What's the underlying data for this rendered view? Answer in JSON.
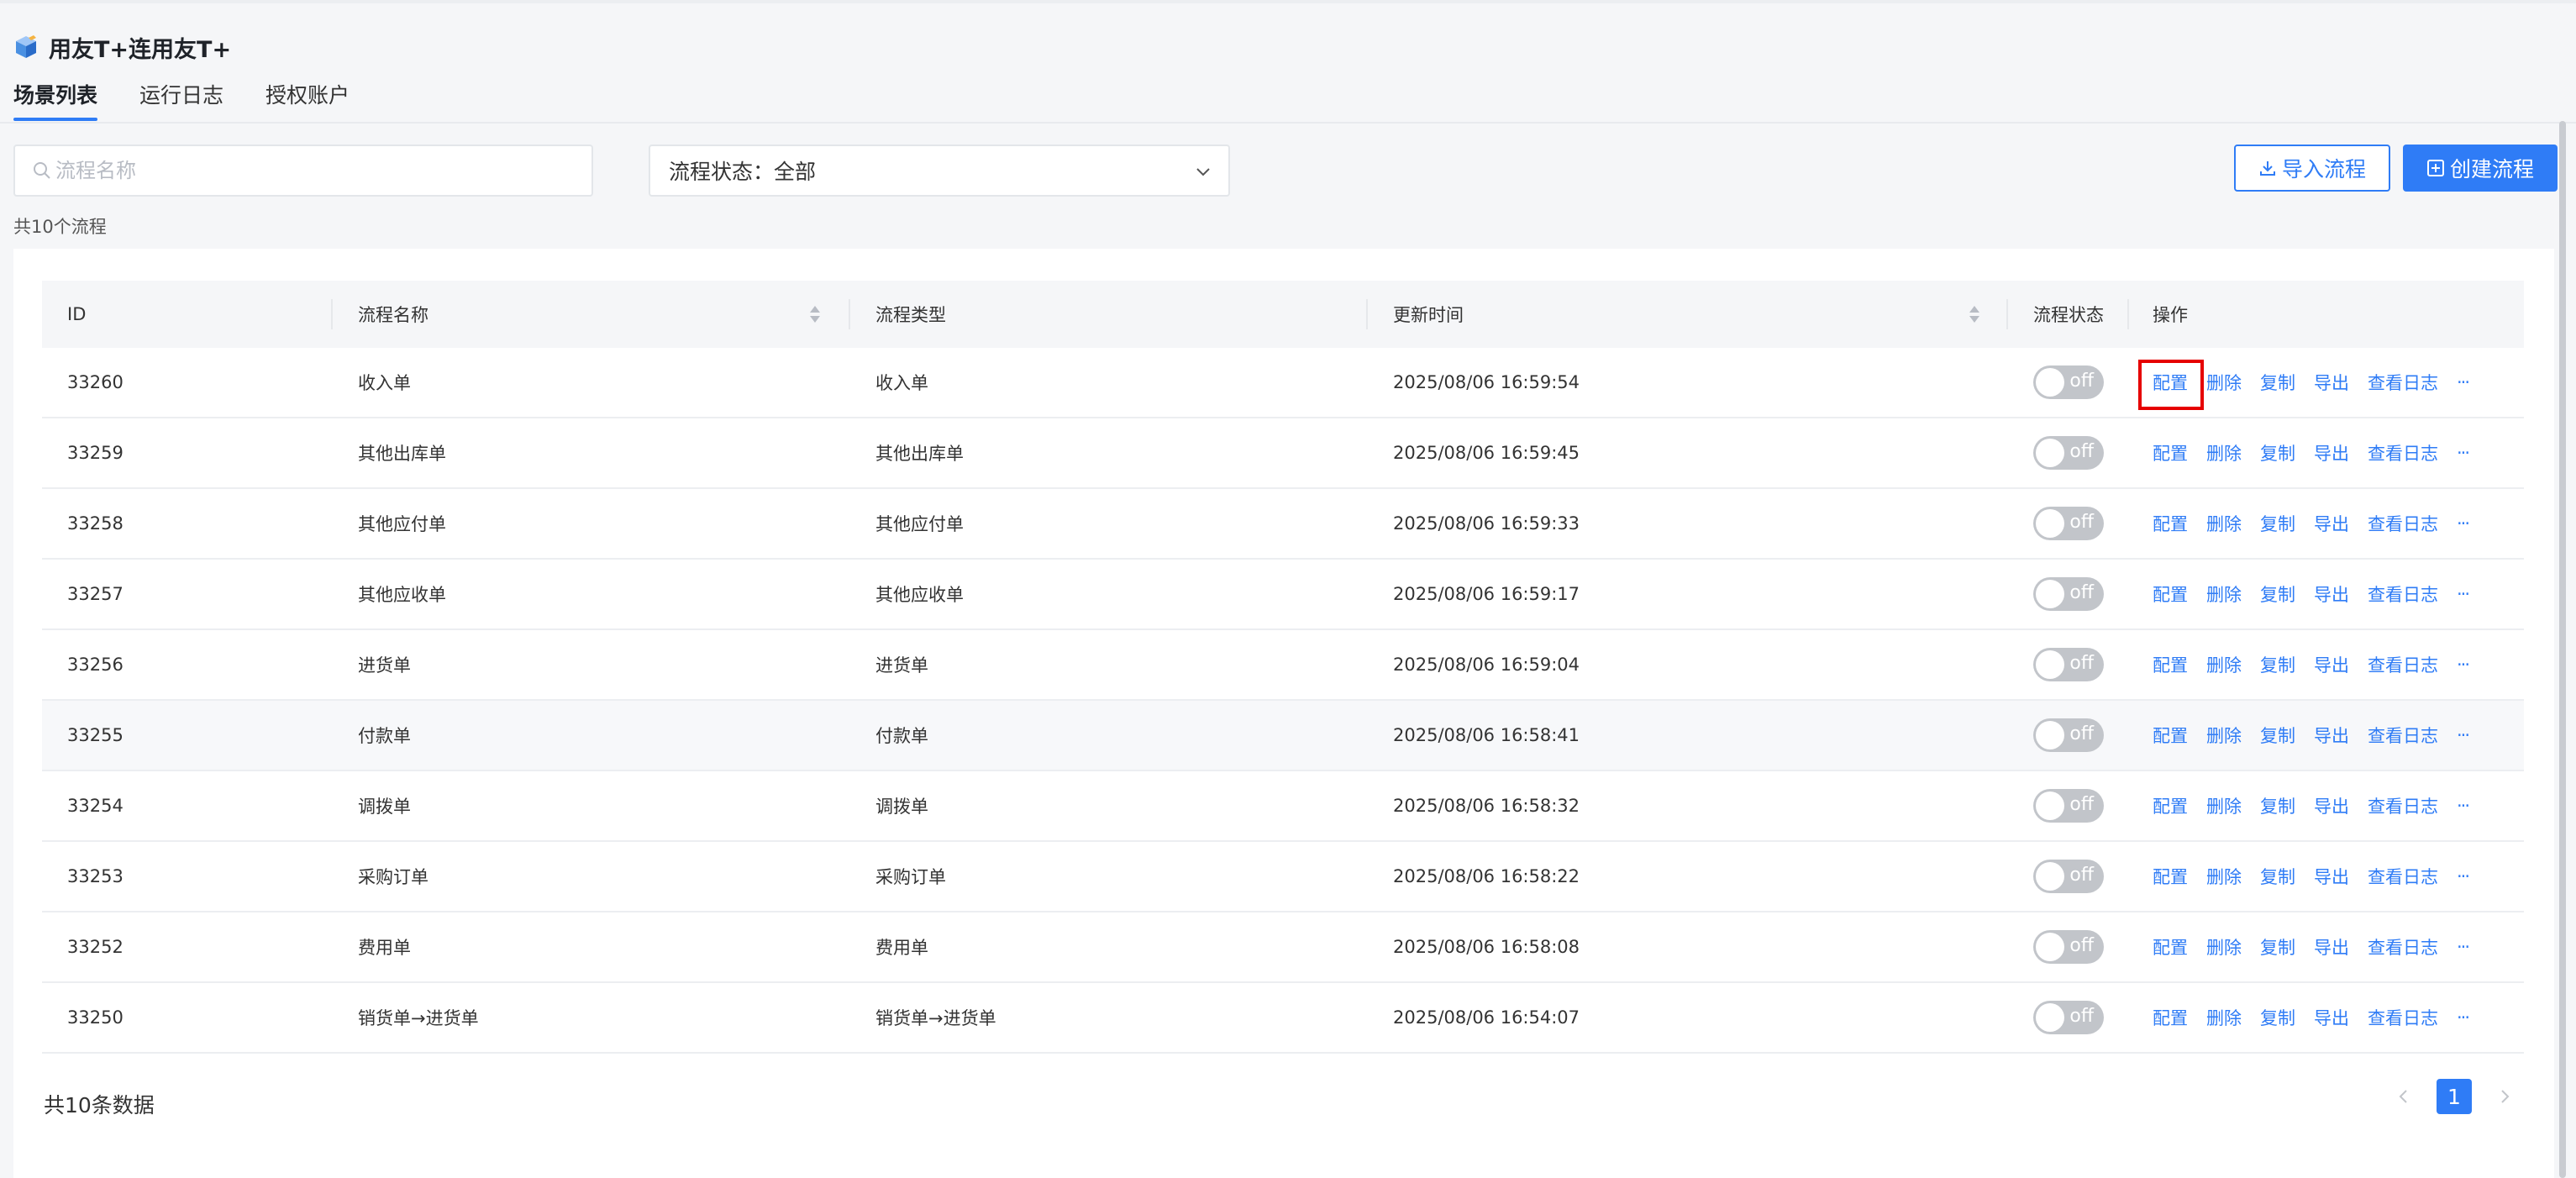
{
  "app": {
    "title": "用友T+连用友T+"
  },
  "tabs": [
    {
      "label": "场景列表",
      "active": true
    },
    {
      "label": "运行日志",
      "active": false
    },
    {
      "label": "授权账户",
      "active": false
    }
  ],
  "toolbar": {
    "search_placeholder": "流程名称",
    "status_filter": "流程状态：全部",
    "import_label": "导入流程",
    "create_label": "创建流程",
    "count_label": "共10个流程"
  },
  "table": {
    "headers": {
      "id": "ID",
      "name": "流程名称",
      "type": "流程类型",
      "updated": "更新时间",
      "status": "流程状态",
      "ops": "操作"
    },
    "actions": [
      "配置",
      "删除",
      "复制",
      "导出",
      "查看日志"
    ],
    "more": "···",
    "switch_text": "off",
    "rows": [
      {
        "id": "33260",
        "name": "收入单",
        "type": "收入单",
        "updated": "2025/08/06 16:59:54"
      },
      {
        "id": "33259",
        "name": "其他出库单",
        "type": "其他出库单",
        "updated": "2025/08/06 16:59:45"
      },
      {
        "id": "33258",
        "name": "其他应付单",
        "type": "其他应付单",
        "updated": "2025/08/06 16:59:33"
      },
      {
        "id": "33257",
        "name": "其他应收单",
        "type": "其他应收单",
        "updated": "2025/08/06 16:59:17"
      },
      {
        "id": "33256",
        "name": "进货单",
        "type": "进货单",
        "updated": "2025/08/06 16:59:04"
      },
      {
        "id": "33255",
        "name": "付款单",
        "type": "付款单",
        "updated": "2025/08/06 16:58:41"
      },
      {
        "id": "33254",
        "name": "调拨单",
        "type": "调拨单",
        "updated": "2025/08/06 16:58:32"
      },
      {
        "id": "33253",
        "name": "采购订单",
        "type": "采购订单",
        "updated": "2025/08/06 16:58:22"
      },
      {
        "id": "33252",
        "name": "费用单",
        "type": "费用单",
        "updated": "2025/08/06 16:58:08"
      },
      {
        "id": "33250",
        "name": "销货单→进货单",
        "type": "销货单→进货单",
        "updated": "2025/08/06 16:54:07"
      }
    ]
  },
  "footer": {
    "total": "共10条数据",
    "current_page": "1"
  },
  "colors": {
    "accent": "#2f7cf6",
    "switch_off": "#c2c5ca",
    "highlight": "#e60000"
  }
}
